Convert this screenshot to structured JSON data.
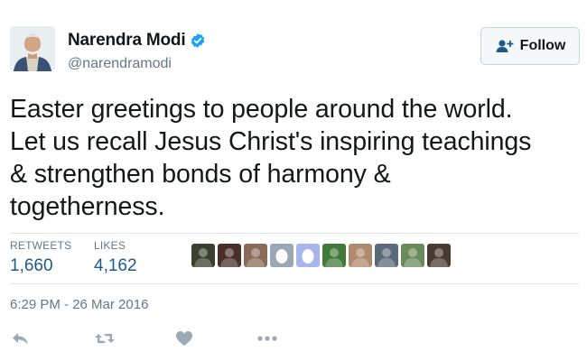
{
  "user": {
    "name": "Narendra Modi",
    "handle": "@narendramodi",
    "verified": true
  },
  "follow_button": {
    "label": "Follow"
  },
  "tweet": {
    "lines": [
      "Easter greetings to people around the world.",
      "Let us recall Jesus Christ's inspiring teachings",
      "& strengthen bonds of harmony &",
      "togetherness."
    ]
  },
  "stats": {
    "retweets_label": "RETWEETS",
    "retweets_value": "1,660",
    "likes_label": "LIKES",
    "likes_value": "4,162"
  },
  "liked_by": [
    {
      "type": "photo",
      "color": "#3a3f2e"
    },
    {
      "type": "photo",
      "color": "#4a2f2a"
    },
    {
      "type": "photo",
      "color": "#8a6b5a"
    },
    {
      "type": "egg",
      "color": "#9aa8b3"
    },
    {
      "type": "egg",
      "color": "#a7b4ee"
    },
    {
      "type": "photo",
      "color": "#3f7a3a"
    },
    {
      "type": "photo",
      "color": "#b08a6c"
    },
    {
      "type": "photo",
      "color": "#5a6a7a"
    },
    {
      "type": "photo",
      "color": "#6b8a5a"
    },
    {
      "type": "photo",
      "color": "#4a3b30"
    }
  ],
  "timestamp": "6:29 PM - 26 Mar 2016",
  "colors": {
    "link": "#1b5a8a",
    "verified": "#1da1f2",
    "muted": "#657786",
    "icon": "#99aab5"
  }
}
